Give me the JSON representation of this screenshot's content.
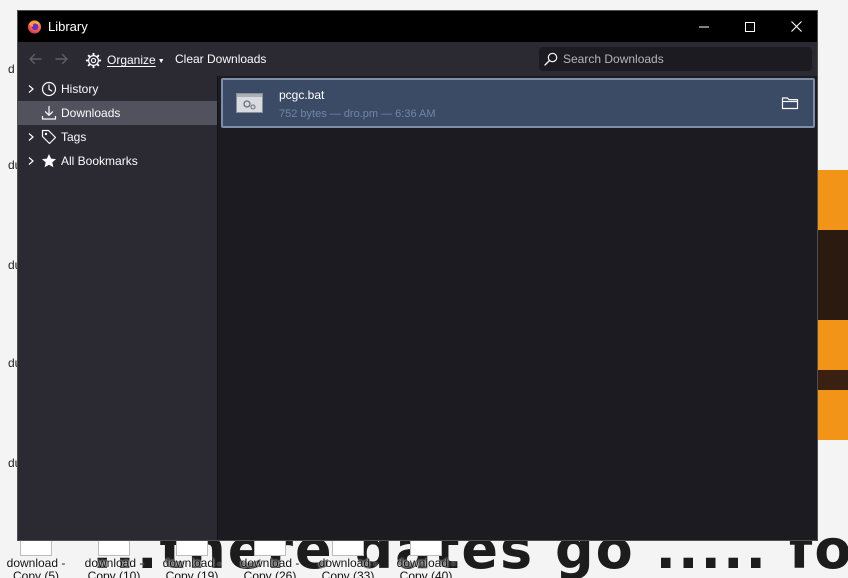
{
  "window": {
    "title": "Library"
  },
  "toolbar": {
    "organize_label": "Organize",
    "clear_label": "Clear Downloads",
    "search_placeholder": "Search Downloads"
  },
  "sidebar": {
    "items": [
      {
        "label": "History",
        "icon": "clock-icon",
        "expandable": true
      },
      {
        "label": "Downloads",
        "icon": "download-icon",
        "expandable": false,
        "selected": true
      },
      {
        "label": "Tags",
        "icon": "tag-icon",
        "expandable": true
      },
      {
        "label": "All Bookmarks",
        "icon": "star-icon",
        "expandable": true
      }
    ]
  },
  "downloads": [
    {
      "name": "pcgc.bat",
      "meta": "752 bytes — dro.pm — 6:36 AM",
      "icon": "batch-file-icon"
    }
  ],
  "desktop": {
    "background_text": "...there dates go ..... for ?",
    "left_labels": [
      "d",
      "du",
      "du",
      "du",
      "du"
    ],
    "icons": [
      {
        "line1": "download -",
        "line2": "Copy (5)"
      },
      {
        "line1": "download -",
        "line2": "Copy (10)"
      },
      {
        "line1": "download -",
        "line2": "Copy (19)"
      },
      {
        "line1": "download -",
        "line2": "Copy (26)"
      },
      {
        "line1": "download -",
        "line2": "Copy (33)"
      },
      {
        "line1": "download -",
        "line2": "Copy (40)"
      }
    ]
  },
  "colors": {
    "window_bg": "#1c1b22",
    "toolbar_bg": "#2b2a33",
    "titlebar_bg": "#000000",
    "selected_row": "#3b4b66",
    "selected_sidebar": "#52525e"
  }
}
